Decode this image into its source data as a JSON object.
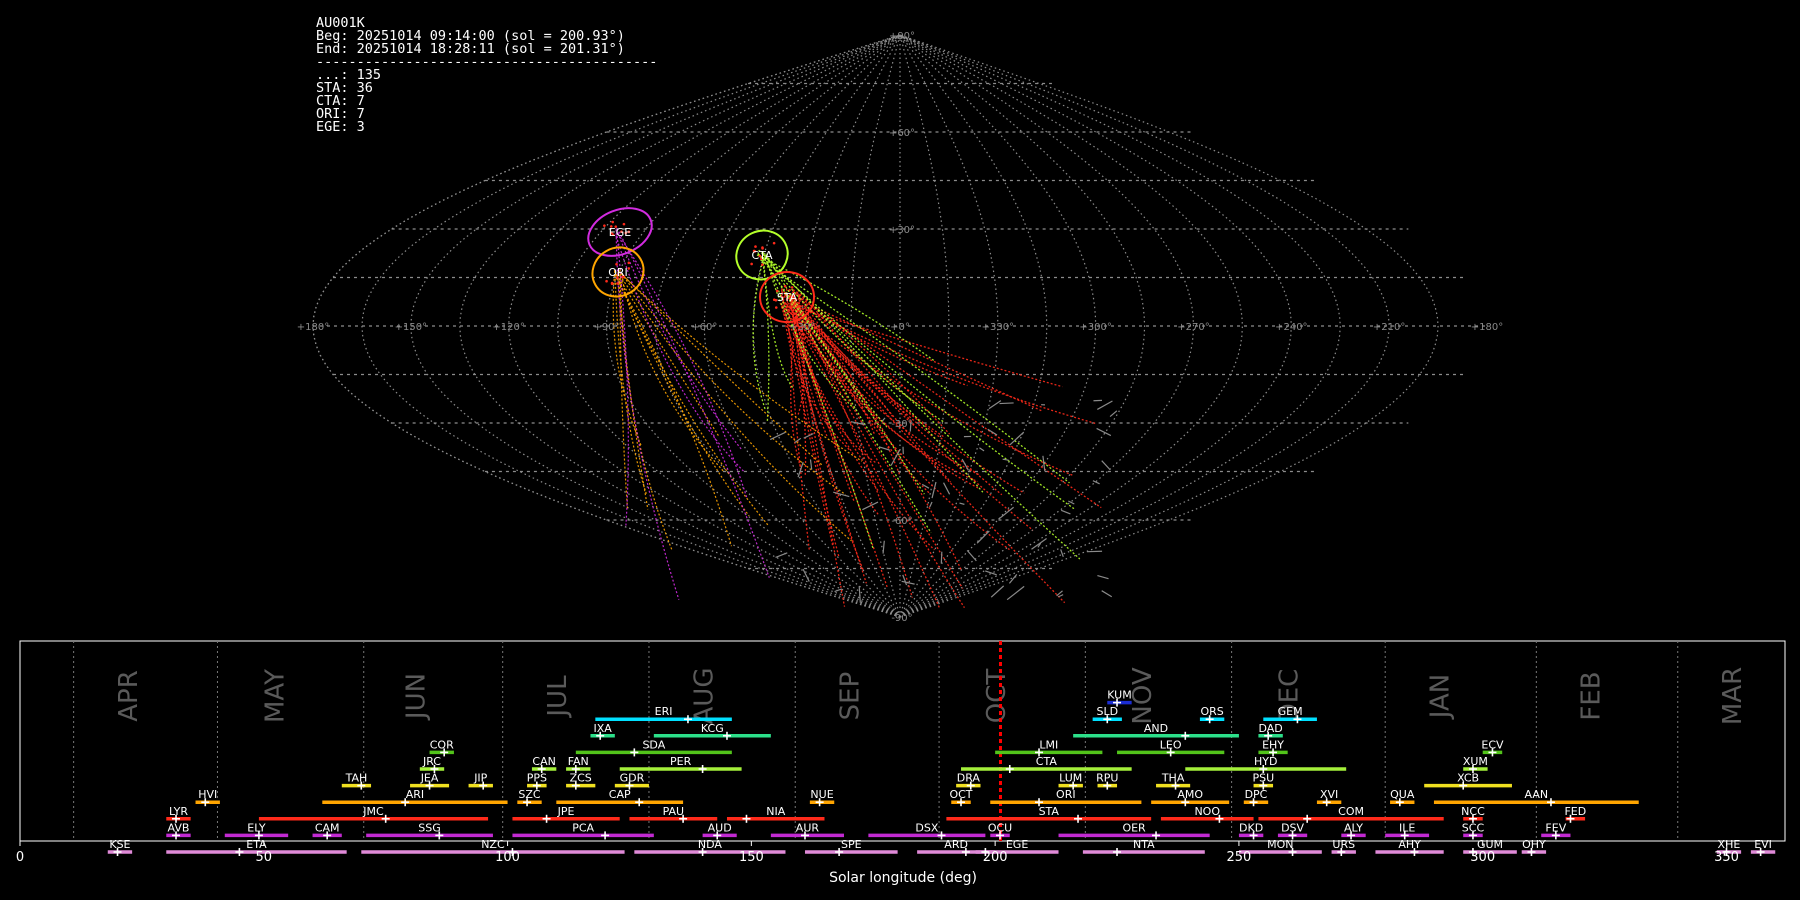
{
  "info": {
    "station": "AU001K",
    "beg": "Beg: 20251014 09:14:00 (sol = 200.93°)",
    "end": "End: 20251014 18:28:11 (sol = 201.31°)",
    "separator": "------------------------------------------",
    "counts": [
      "...: 135",
      "STA: 36",
      "CTA: 7",
      "ORI: 7",
      "EGE: 3"
    ]
  },
  "colors": {
    "grid": "#8c8c8c",
    "sporadic": "#8a8a8a",
    "STA": "#ff2a1a",
    "CTA": "#b4ff2a",
    "ORI": "#ffa500",
    "EGE": "#d22be0",
    "current_sol": "#ff0000",
    "month_text": "#5a5a5a"
  },
  "chart_data": [
    {
      "type": "scatter",
      "projection": "sinusoidal all-sky (radiant map)",
      "lon_tick_labels": [
        "+180°",
        "+150°",
        "+120°",
        "+90°",
        "+60°",
        "+30°",
        "+0°",
        "+330°",
        "+300°",
        "+270°",
        "+240°",
        "+210°",
        "+180°"
      ],
      "lat_tick_labels": [
        "+90°",
        "+60°",
        "+30°",
        "-30°",
        "-60°",
        "-90°"
      ],
      "grid": true,
      "radiants": [
        {
          "name": "EGE",
          "lon": 102,
          "lat": 27,
          "rx": 22,
          "ry": 10,
          "tilt": -22
        },
        {
          "name": "ORI",
          "lon": 94,
          "lat": 16,
          "rx": 17,
          "ry": 12,
          "tilt": -30
        },
        {
          "name": "CTA",
          "lon": 42,
          "lat": 20,
          "rx": 18,
          "ry": 13,
          "tilt": -25
        },
        {
          "name": "STA",
          "lon": 34,
          "lat": 7,
          "rx": 16,
          "ry": 12,
          "tilt": 0
        }
      ]
    },
    {
      "type": "timeline",
      "xlabel": "Solar longitude (deg)",
      "xlim": [
        0,
        362
      ],
      "x_ticks": [
        0,
        50,
        100,
        150,
        200,
        250,
        300,
        350
      ],
      "current_sol": 201.1,
      "months": [
        {
          "label": "APR",
          "boundary": 11,
          "text_x": 24
        },
        {
          "label": "MAY",
          "boundary": 40.5,
          "text_x": 54
        },
        {
          "label": "JUN",
          "boundary": 70.5,
          "text_x": 83
        },
        {
          "label": "JUL",
          "boundary": 99,
          "text_x": 112
        },
        {
          "label": "AUG",
          "boundary": 129,
          "text_x": 142
        },
        {
          "label": "SEP",
          "boundary": 159,
          "text_x": 172
        },
        {
          "label": "OCT",
          "boundary": 188.5,
          "text_x": 202
        },
        {
          "label": "NOV",
          "boundary": 218.5,
          "text_x": 232
        },
        {
          "label": "DEC",
          "boundary": 248.5,
          "text_x": 262
        },
        {
          "label": "JAN",
          "boundary": 280,
          "text_x": 293
        },
        {
          "label": "FEB",
          "boundary": 311,
          "text_x": 324
        },
        {
          "label": "MAR",
          "boundary": 340,
          "text_x": 353
        }
      ],
      "showers": [
        {
          "code": "KUM",
          "start": 223,
          "end": 228,
          "peak": 225,
          "row": 1,
          "color": "#1a2cd2"
        },
        {
          "code": "ERI",
          "start": 118,
          "end": 146,
          "peak": 137,
          "row": 2,
          "color": "#00e0ff"
        },
        {
          "code": "SLD",
          "start": 220,
          "end": 226,
          "peak": 223,
          "row": 2,
          "color": "#00e0ff"
        },
        {
          "code": "ORS",
          "start": 242,
          "end": 247,
          "peak": 244,
          "row": 2,
          "color": "#00e0ff"
        },
        {
          "code": "GEM",
          "start": 255,
          "end": 266,
          "peak": 262,
          "row": 2,
          "color": "#00e0ff"
        },
        {
          "code": "IXA",
          "start": 117,
          "end": 122,
          "peak": 119,
          "row": 3,
          "color": "#2ce08a"
        },
        {
          "code": "KCG",
          "start": 130,
          "end": 154,
          "peak": 145,
          "row": 3,
          "color": "#2ce08a"
        },
        {
          "code": "AND",
          "start": 216,
          "end": 250,
          "peak": 239,
          "row": 3,
          "color": "#2ce08a"
        },
        {
          "code": "DAD",
          "start": 254,
          "end": 259,
          "peak": 256,
          "row": 3,
          "color": "#2ce08a"
        },
        {
          "code": "COR",
          "start": 84,
          "end": 89,
          "peak": 87,
          "row": 4,
          "color": "#52c41a"
        },
        {
          "code": "SDA",
          "start": 114,
          "end": 146,
          "peak": 126,
          "row": 4,
          "color": "#52c41a"
        },
        {
          "code": "LMI",
          "start": 200,
          "end": 222,
          "peak": 209,
          "row": 4,
          "color": "#52c41a"
        },
        {
          "code": "LEO",
          "start": 225,
          "end": 247,
          "peak": 236,
          "row": 4,
          "color": "#52c41a"
        },
        {
          "code": "EHY",
          "start": 254,
          "end": 260,
          "peak": 257,
          "row": 4,
          "color": "#52c41a"
        },
        {
          "code": "ECV",
          "start": 300,
          "end": 304,
          "peak": 302,
          "row": 4,
          "color": "#52c41a"
        },
        {
          "code": "JRC",
          "start": 82,
          "end": 87,
          "peak": 85,
          "row": 5,
          "color": "#a4f03a"
        },
        {
          "code": "CAN",
          "start": 105,
          "end": 110,
          "peak": 107,
          "row": 5,
          "color": "#a4f03a"
        },
        {
          "code": "FAN",
          "start": 112,
          "end": 117,
          "peak": 114,
          "row": 5,
          "color": "#a4f03a"
        },
        {
          "code": "PER",
          "start": 123,
          "end": 148,
          "peak": 140,
          "row": 5,
          "color": "#a4f03a"
        },
        {
          "code": "CTA",
          "start": 193,
          "end": 228,
          "peak": 203,
          "row": 5,
          "color": "#a4f03a"
        },
        {
          "code": "HYD",
          "start": 239,
          "end": 272,
          "peak": 255,
          "row": 5,
          "color": "#a4f03a"
        },
        {
          "code": "XUM",
          "start": 296,
          "end": 301,
          "peak": 298,
          "row": 5,
          "color": "#a4f03a"
        },
        {
          "code": "TAH",
          "start": 66,
          "end": 72,
          "peak": 70,
          "row": 6,
          "color": "#f0e020"
        },
        {
          "code": "JEA",
          "start": 80,
          "end": 88,
          "peak": 84,
          "row": 6,
          "color": "#f0e020"
        },
        {
          "code": "JIP",
          "start": 92,
          "end": 97,
          "peak": 95,
          "row": 6,
          "color": "#f0e020"
        },
        {
          "code": "PPS",
          "start": 104,
          "end": 108,
          "peak": 106,
          "row": 6,
          "color": "#f0e020"
        },
        {
          "code": "ZCS",
          "start": 112,
          "end": 118,
          "peak": 114,
          "row": 6,
          "color": "#f0e020"
        },
        {
          "code": "GDR",
          "start": 122,
          "end": 129,
          "peak": 125,
          "row": 6,
          "color": "#f0e020"
        },
        {
          "code": "DRA",
          "start": 192,
          "end": 197,
          "peak": 195,
          "row": 6,
          "color": "#f0e020"
        },
        {
          "code": "LUM",
          "start": 213,
          "end": 218,
          "peak": 216,
          "row": 6,
          "color": "#f0e020"
        },
        {
          "code": "RPU",
          "start": 221,
          "end": 225,
          "peak": 223,
          "row": 6,
          "color": "#f0e020"
        },
        {
          "code": "THA",
          "start": 233,
          "end": 240,
          "peak": 237,
          "row": 6,
          "color": "#f0e020"
        },
        {
          "code": "PSU",
          "start": 253,
          "end": 257,
          "peak": 255,
          "row": 6,
          "color": "#f0e020"
        },
        {
          "code": "XCB",
          "start": 288,
          "end": 306,
          "peak": 296,
          "row": 6,
          "color": "#f0e020"
        },
        {
          "code": "HVI",
          "start": 36,
          "end": 41,
          "peak": 38,
          "row": 7,
          "color": "#ffa500"
        },
        {
          "code": "ARI",
          "start": 62,
          "end": 100,
          "peak": 79,
          "row": 7,
          "color": "#ffa500"
        },
        {
          "code": "SZC",
          "start": 102,
          "end": 107,
          "peak": 104,
          "row": 7,
          "color": "#ffa500"
        },
        {
          "code": "CAP",
          "start": 110,
          "end": 136,
          "peak": 127,
          "row": 7,
          "color": "#ffa500"
        },
        {
          "code": "NUE",
          "start": 162,
          "end": 167,
          "peak": 164,
          "row": 7,
          "color": "#ffa500"
        },
        {
          "code": "OCT",
          "start": 191,
          "end": 195,
          "peak": 193,
          "row": 7,
          "color": "#ffa500"
        },
        {
          "code": "ORI",
          "start": 199,
          "end": 230,
          "peak": 209,
          "row": 7,
          "color": "#ffa500"
        },
        {
          "code": "AMO",
          "start": 232,
          "end": 248,
          "peak": 239,
          "row": 7,
          "color": "#ffa500"
        },
        {
          "code": "DPC",
          "start": 251,
          "end": 256,
          "peak": 253,
          "row": 7,
          "color": "#ffa500"
        },
        {
          "code": "XVI",
          "start": 266,
          "end": 271,
          "peak": 268,
          "row": 7,
          "color": "#ffa500"
        },
        {
          "code": "QUA",
          "start": 281,
          "end": 286,
          "peak": 283,
          "row": 7,
          "color": "#ffa500"
        },
        {
          "code": "AAN",
          "start": 290,
          "end": 332,
          "peak": 314,
          "row": 7,
          "color": "#ffa500"
        },
        {
          "code": "LYR",
          "start": 30,
          "end": 35,
          "peak": 32,
          "row": 8,
          "color": "#ff2a1a"
        },
        {
          "code": "JMC",
          "start": 49,
          "end": 96,
          "peak": 75,
          "row": 8,
          "color": "#ff2a1a"
        },
        {
          "code": "JPE",
          "start": 101,
          "end": 123,
          "peak": 108,
          "row": 8,
          "color": "#ff2a1a"
        },
        {
          "code": "PAU",
          "start": 125,
          "end": 143,
          "peak": 136,
          "row": 8,
          "color": "#ff2a1a"
        },
        {
          "code": "NIA",
          "start": 145,
          "end": 165,
          "peak": 149,
          "row": 8,
          "color": "#ff2a1a"
        },
        {
          "code": "STA",
          "start": 190,
          "end": 232,
          "peak": 217,
          "row": 8,
          "color": "#ff2a1a"
        },
        {
          "code": "NOO",
          "start": 234,
          "end": 253,
          "peak": 246,
          "row": 8,
          "color": "#ff2a1a"
        },
        {
          "code": "COM",
          "start": 254,
          "end": 292,
          "peak": 264,
          "row": 8,
          "color": "#ff2a1a"
        },
        {
          "code": "NCC",
          "start": 296,
          "end": 300,
          "peak": 298,
          "row": 8,
          "color": "#ff2a1a"
        },
        {
          "code": "FED",
          "start": 317,
          "end": 321,
          "peak": 318,
          "row": 8,
          "color": "#ff2a1a"
        },
        {
          "code": "AVB",
          "start": 30,
          "end": 35,
          "peak": 32,
          "row": 9,
          "color": "#c22ad2"
        },
        {
          "code": "ELY",
          "start": 42,
          "end": 55,
          "peak": 49,
          "row": 9,
          "color": "#c22ad2"
        },
        {
          "code": "CAM",
          "start": 60,
          "end": 66,
          "peak": 63,
          "row": 9,
          "color": "#c22ad2"
        },
        {
          "code": "SSG",
          "start": 71,
          "end": 97,
          "peak": 86,
          "row": 9,
          "color": "#c22ad2"
        },
        {
          "code": "PCA",
          "start": 101,
          "end": 130,
          "peak": 120,
          "row": 9,
          "color": "#c22ad2"
        },
        {
          "code": "AUD",
          "start": 140,
          "end": 147,
          "peak": 143,
          "row": 9,
          "color": "#c22ad2"
        },
        {
          "code": "AUR",
          "start": 154,
          "end": 169,
          "peak": 161,
          "row": 9,
          "color": "#c22ad2"
        },
        {
          "code": "DSX",
          "start": 174,
          "end": 198,
          "peak": 189,
          "row": 9,
          "color": "#c22ad2"
        },
        {
          "code": "OCU",
          "start": 199,
          "end": 203,
          "peak": 201,
          "row": 9,
          "color": "#c22ad2"
        },
        {
          "code": "OER",
          "start": 213,
          "end": 244,
          "peak": 233,
          "row": 9,
          "color": "#c22ad2"
        },
        {
          "code": "DKD",
          "start": 250,
          "end": 255,
          "peak": 253,
          "row": 9,
          "color": "#c22ad2"
        },
        {
          "code": "DSV",
          "start": 258,
          "end": 264,
          "peak": 261,
          "row": 9,
          "color": "#c22ad2"
        },
        {
          "code": "ALY",
          "start": 271,
          "end": 276,
          "peak": 273,
          "row": 9,
          "color": "#c22ad2"
        },
        {
          "code": "ILE",
          "start": 280,
          "end": 289,
          "peak": 284,
          "row": 9,
          "color": "#c22ad2"
        },
        {
          "code": "SCC",
          "start": 296,
          "end": 300,
          "peak": 298,
          "row": 9,
          "color": "#c22ad2"
        },
        {
          "code": "FEV",
          "start": 312,
          "end": 318,
          "peak": 315,
          "row": 9,
          "color": "#c22ad2"
        },
        {
          "code": "KSE",
          "start": 18,
          "end": 23,
          "peak": 20,
          "row": 10,
          "color": "#e08ad8"
        },
        {
          "code": "ETA",
          "start": 30,
          "end": 67,
          "peak": 45,
          "row": 10,
          "color": "#e08ad8"
        },
        {
          "code": "NZC",
          "start": 70,
          "end": 124,
          "peak": 101,
          "row": 10,
          "color": "#e08ad8"
        },
        {
          "code": "NDA",
          "start": 126,
          "end": 157,
          "peak": 140,
          "row": 10,
          "color": "#e08ad8"
        },
        {
          "code": "SPE",
          "start": 161,
          "end": 180,
          "peak": 168,
          "row": 10,
          "color": "#e08ad8"
        },
        {
          "code": "ARD",
          "start": 184,
          "end": 200,
          "peak": 194,
          "row": 10,
          "color": "#e08ad8"
        },
        {
          "code": "EGE",
          "start": 196,
          "end": 213,
          "peak": 198,
          "row": 10,
          "color": "#e08ad8"
        },
        {
          "code": "NTA",
          "start": 218,
          "end": 243,
          "peak": 225,
          "row": 10,
          "color": "#e08ad8"
        },
        {
          "code": "MON",
          "start": 250,
          "end": 267,
          "peak": 261,
          "row": 10,
          "color": "#e08ad8"
        },
        {
          "code": "URS",
          "start": 269,
          "end": 274,
          "peak": 271,
          "row": 10,
          "color": "#e08ad8"
        },
        {
          "code": "AHY",
          "start": 278,
          "end": 292,
          "peak": 286,
          "row": 10,
          "color": "#e08ad8"
        },
        {
          "code": "GUM",
          "start": 296,
          "end": 307,
          "peak": 298,
          "row": 10,
          "color": "#e08ad8"
        },
        {
          "code": "OHY",
          "start": 308,
          "end": 313,
          "peak": 310,
          "row": 10,
          "color": "#e08ad8"
        },
        {
          "code": "XHE",
          "start": 348,
          "end": 353,
          "peak": 350,
          "row": 10,
          "color": "#e08ad8"
        },
        {
          "code": "EVI",
          "start": 355,
          "end": 360,
          "peak": 357,
          "row": 10,
          "color": "#e08ad8"
        }
      ]
    }
  ]
}
